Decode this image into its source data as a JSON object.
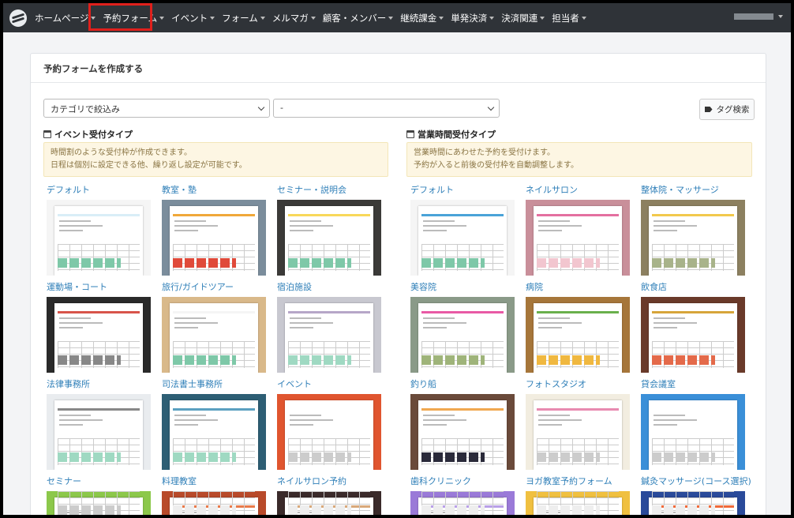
{
  "nav": {
    "items": [
      {
        "label": "ホームページ"
      },
      {
        "label": "予約フォーム"
      },
      {
        "label": "イベント"
      },
      {
        "label": "フォーム"
      },
      {
        "label": "メルマガ"
      },
      {
        "label": "顧客・メンバー"
      },
      {
        "label": "継続課金"
      },
      {
        "label": "単発決済"
      },
      {
        "label": "決済関連"
      },
      {
        "label": "担当者"
      }
    ],
    "highlight_color": "#e0201c"
  },
  "card": {
    "title": "予約フォームを作成する",
    "category_select": "カテゴリで絞込み",
    "sub_select": "-",
    "tag_search": "タグ検索"
  },
  "event_section": {
    "title": "イベント受付タイプ",
    "info_line1": "時間割のような受付枠が作成できます。",
    "info_line2": "日程は個別に設定できる他、繰り返し設定が可能です。"
  },
  "hours_section": {
    "title": "営業時間受付タイプ",
    "info_line1": "営業時間にあわせた予約を受付けます。",
    "info_line2": "予約が入ると前後の受付枠を自動調整します。"
  },
  "templates": [
    "デフォルト",
    "教室・塾",
    "セミナー・説明会",
    "デフォルト",
    "ネイルサロン",
    "整体院・マッサージ",
    "運動場・コート",
    "旅行/ガイドツアー",
    "宿泊施設",
    "美容院",
    "病院",
    "飲食店",
    "法律事務所",
    "司法書士事務所",
    "イベント",
    "釣り船",
    "フォトスタジオ",
    "貸会議室",
    "セミナー",
    "料理教室",
    "ネイルサロン予約",
    "歯科クリニック",
    "ヨガ教室予約フォーム",
    "鍼灸マッサージ(コース選択)"
  ],
  "colors": {
    "navbar": "#2f3338",
    "link": "#2f7fb8",
    "info_bg": "#fdf6e3",
    "info_text": "#8a7544"
  }
}
